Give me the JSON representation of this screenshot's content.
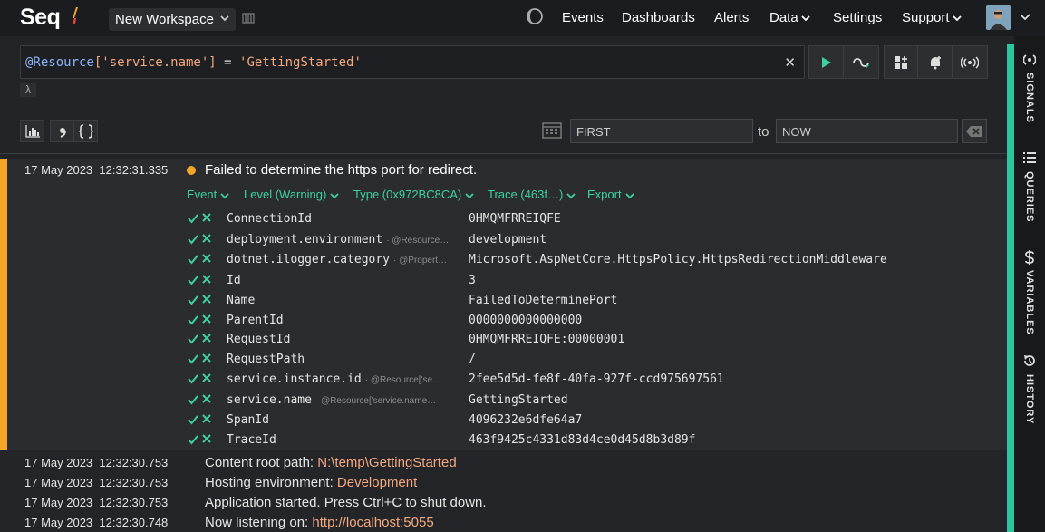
{
  "app": {
    "logo_text": "Seq",
    "workspace": "New Workspace",
    "nav": [
      "Events",
      "Dashboards",
      "Alerts",
      "Data",
      "Settings",
      "Support"
    ],
    "accent_color": "#2bc6a0",
    "warning_color": "#f5a52a"
  },
  "search": {
    "query_resource": "@Resource",
    "query_key": "['service.name']",
    "query_op": " = ",
    "query_value": "'GettingStarted'",
    "lambda": "λ",
    "clear_glyph": "✕"
  },
  "range": {
    "from_placeholder": "FIRST",
    "to_label": "to",
    "to_placeholder": "NOW"
  },
  "expanded_event": {
    "timestamp": "17 May 2023  12:32:31.335",
    "message": "Failed to determine the https port for redirect.",
    "pills": [
      "Event",
      "Level (Warning)",
      "Type (0x972BC8CA)",
      "Trace (463f…)",
      "Export"
    ],
    "properties": [
      {
        "name": "ConnectionId",
        "source": "",
        "value": "0HMQMFRREIQFE"
      },
      {
        "name": "deployment.environment",
        "source": "· @Resource…",
        "value": "development"
      },
      {
        "name": "dotnet.ilogger.category",
        "source": "· @Propert…",
        "value": "Microsoft.AspNetCore.HttpsPolicy.HttpsRedirectionMiddleware"
      },
      {
        "name": "Id",
        "source": "",
        "value": "3"
      },
      {
        "name": "Name",
        "source": "",
        "value": "FailedToDeterminePort"
      },
      {
        "name": "ParentId",
        "source": "",
        "value": "0000000000000000"
      },
      {
        "name": "RequestId",
        "source": "",
        "value": "0HMQMFRREIQFE:00000001"
      },
      {
        "name": "RequestPath",
        "source": "",
        "value": "/"
      },
      {
        "name": "service.instance.id",
        "source": "· @Resource['se…",
        "value": "2fee5d5d-fe8f-40fa-927f-ccd975697561"
      },
      {
        "name": "service.name",
        "source": "· @Resource['service.name…",
        "value": "GettingStarted"
      },
      {
        "name": "SpanId",
        "source": "",
        "value": "4096232e6dfe64a7"
      },
      {
        "name": "TraceId",
        "source": "",
        "value": "463f9425c4331d83d4ce0d45d8b3d89f"
      }
    ]
  },
  "events": [
    {
      "timestamp": "17 May 2023  12:32:30.753",
      "text": "Content root path: ",
      "value": "N:\\temp\\GettingStarted"
    },
    {
      "timestamp": "17 May 2023  12:32:30.753",
      "text": "Hosting environment: ",
      "value": "Development"
    },
    {
      "timestamp": "17 May 2023  12:32:30.753",
      "text": "Application started. Press Ctrl+C to shut down.",
      "value": ""
    },
    {
      "timestamp": "17 May 2023  12:32:30.748",
      "text": "Now listening on: ",
      "value": "http://localhost:5055"
    }
  ],
  "sidebar": [
    "SIGNALS",
    "QUERIES",
    "VARIABLES",
    "HISTORY"
  ],
  "icons": {
    "theme": "moon-icon",
    "run": "play-icon",
    "tail": "tail-icon",
    "add_dashboard": "add-dashboard-icon",
    "add_alert": "add-alert-icon",
    "signal": "broadcast-icon",
    "histogram": "histogram-icon",
    "comma": "comma-icon",
    "json": "braces-icon",
    "calendar": "calendar-icon",
    "backspace": "backspace-icon"
  }
}
